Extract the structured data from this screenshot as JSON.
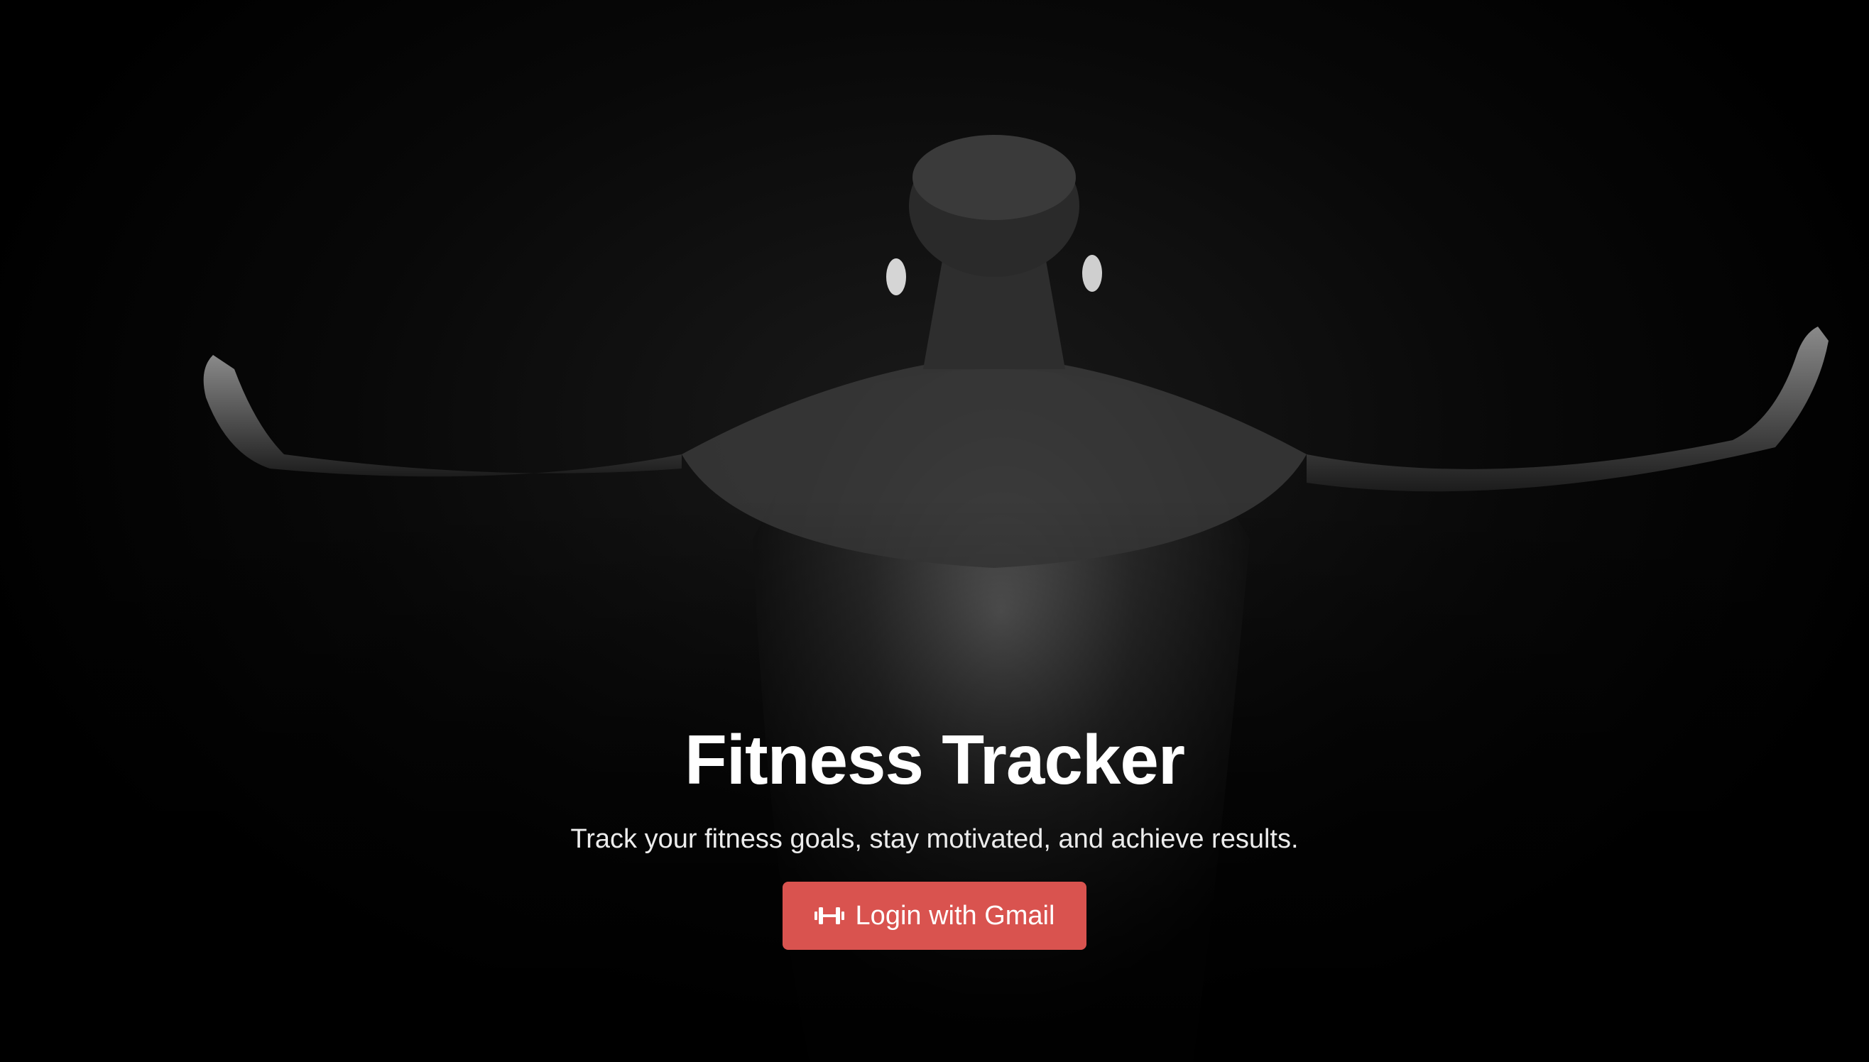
{
  "hero": {
    "title": "Fitness Tracker",
    "subtitle": "Track your fitness goals, stay motivated, and achieve results.",
    "login_button": {
      "label": "Login with Gmail",
      "icon": "dumbbell-icon",
      "color": "#d9534f"
    },
    "background": {
      "description_icon": "athlete-back-photo",
      "color": "#000000"
    }
  }
}
